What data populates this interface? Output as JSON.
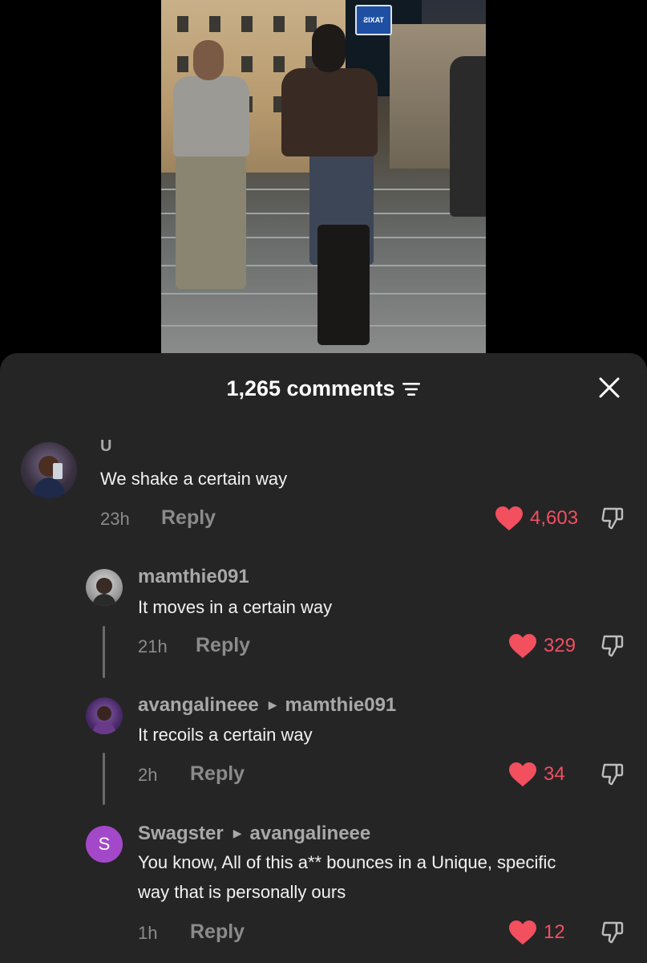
{
  "video": {
    "sign_text": "TAXIS"
  },
  "sheet": {
    "title": "1,265 comments",
    "icons": {
      "filter": "filter-icon",
      "close": "close-icon"
    }
  },
  "comments": [
    {
      "username": "U",
      "text": "We shake a certain way",
      "time": "23h",
      "reply_label": "Reply",
      "likes": "4,603"
    },
    {
      "username": "mamthie091",
      "text": "It moves in a certain way",
      "time": "21h",
      "reply_label": "Reply",
      "likes": "329"
    },
    {
      "username": "avangalineee",
      "reply_to": "mamthie091",
      "text": "It recoils a certain way",
      "time": "2h",
      "reply_label": "Reply",
      "likes": "34"
    },
    {
      "username": "Swagster",
      "reply_to": "avangalineee",
      "avatar_letter": "S",
      "text_line1": "You know, All of this a** bounces in a Unique, specific",
      "text_line2": "way that is personally ours",
      "time": "1h",
      "reply_label": "Reply",
      "likes": "12"
    }
  ],
  "colors": {
    "sheet_bg": "#252526",
    "like_red": "#f24f5f",
    "muted": "#8b8b8b",
    "avatar_purple": "#a348c8"
  }
}
